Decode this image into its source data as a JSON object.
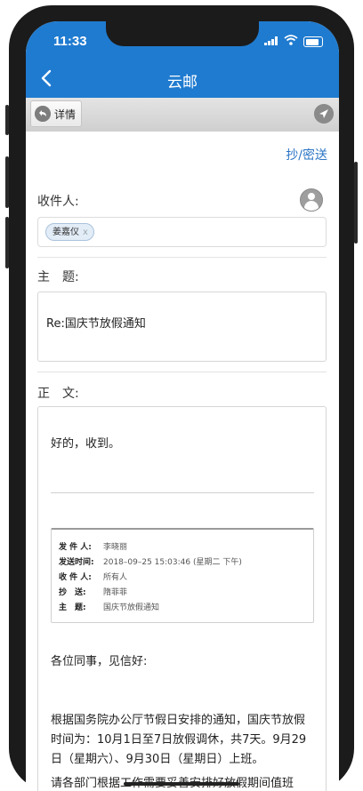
{
  "status": {
    "time": "11:33"
  },
  "nav": {
    "back_icon": "chevron-left-icon",
    "title": "云邮"
  },
  "toolbar": {
    "detail_label": "详情",
    "detail_icon": "reply-icon",
    "send_icon": "send-icon"
  },
  "compose": {
    "cc_bcc_link": "抄/密送",
    "recipient_label": "收件人:",
    "recipients": [
      "姜嘉仪"
    ],
    "chip_remove": "x",
    "subject_label": "主　题:",
    "subject_value": "Re:国庆节放假通知",
    "body_label": "正　文:",
    "reply_text": "好的，收到。"
  },
  "quote": {
    "from_key": "发 件 人:",
    "from_val": "李晓丽",
    "time_key": "发送时间:",
    "time_val": "2018–09–25 15:03:46 (星期二 下午)",
    "to_key": "收 件 人:",
    "to_val": "所有人",
    "cc_key": "抄　送:",
    "cc_val": "隋菲菲",
    "subject_key": "主　题:",
    "subject_val": "国庆节放假通知"
  },
  "message": {
    "greeting": "各位同事，见信好:",
    "para1": "根据国务院办公厅节假日安排的通知，国庆节放假时间为：10月1日至7日放假调休，共7天。9月29日（星期六）、9月30日（星期日）上班。",
    "para2": "请各部门根据工作需要妥善安排好放假期间值班"
  },
  "colors": {
    "accent": "#1f7bd0",
    "link": "#2b74c4"
  }
}
